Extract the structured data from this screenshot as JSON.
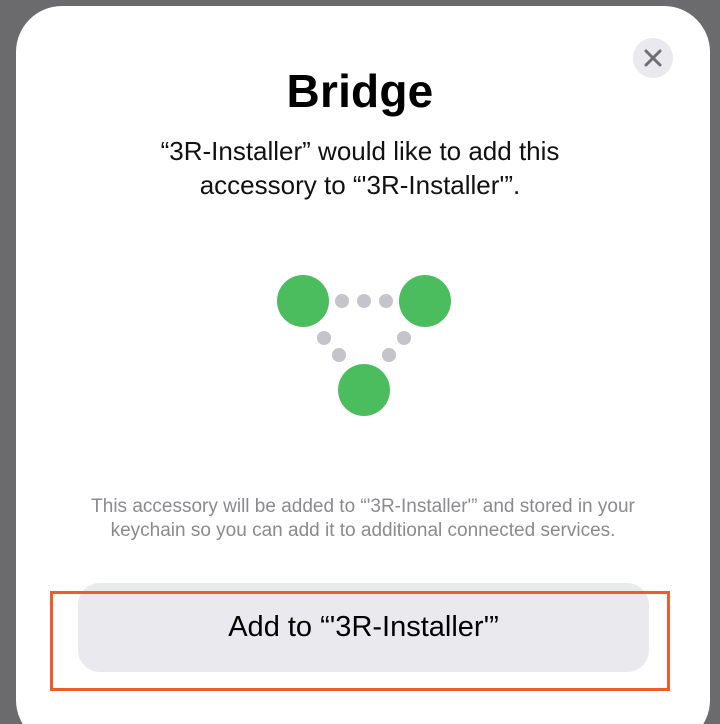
{
  "dialog": {
    "title": "Bridge",
    "subtitle": "“3R-Installer” would like to add this accessory to “'3R-Installer'”.",
    "info": "This accessory will be added to “'3R-Installer'” and stored in your keychain so you can add it to additional connected services.",
    "add_button_label": "Add to “'3R-Installer'”",
    "close_icon": "close-icon"
  },
  "colors": {
    "node_green": "#4cbd5f",
    "dot_gray": "#c4c4ca",
    "button_bg": "#e9e9ee",
    "highlight": "#ef5b2a"
  }
}
